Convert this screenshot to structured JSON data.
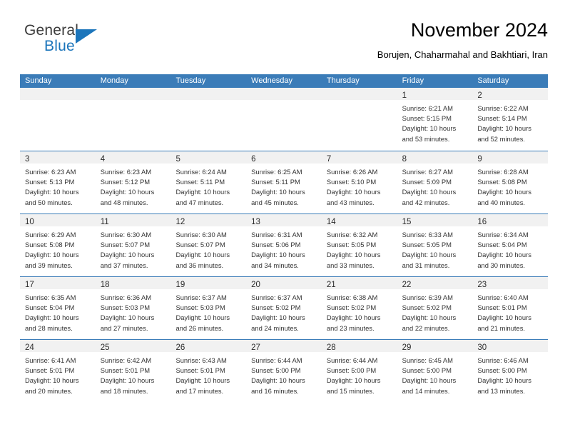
{
  "brand": {
    "name_part1": "General",
    "name_part2": "Blue",
    "color_primary": "#1b75bb",
    "color_text": "#3c3c3c",
    "triangle_icon": "triangle-icon"
  },
  "header": {
    "title": "November 2024",
    "subtitle": "Borujen, Chaharmahal and Bakhtiari, Iran"
  },
  "calendar": {
    "header_bg": "#3b7cb8",
    "daynum_bg": "#f1f1f1",
    "weekdays": [
      "Sunday",
      "Monday",
      "Tuesday",
      "Wednesday",
      "Thursday",
      "Friday",
      "Saturday"
    ],
    "weeks": [
      [
        {
          "day": "",
          "lines": []
        },
        {
          "day": "",
          "lines": []
        },
        {
          "day": "",
          "lines": []
        },
        {
          "day": "",
          "lines": []
        },
        {
          "day": "",
          "lines": []
        },
        {
          "day": "1",
          "lines": [
            "Sunrise: 6:21 AM",
            "Sunset: 5:15 PM",
            "Daylight: 10 hours",
            "and 53 minutes."
          ]
        },
        {
          "day": "2",
          "lines": [
            "Sunrise: 6:22 AM",
            "Sunset: 5:14 PM",
            "Daylight: 10 hours",
            "and 52 minutes."
          ]
        }
      ],
      [
        {
          "day": "3",
          "lines": [
            "Sunrise: 6:23 AM",
            "Sunset: 5:13 PM",
            "Daylight: 10 hours",
            "and 50 minutes."
          ]
        },
        {
          "day": "4",
          "lines": [
            "Sunrise: 6:23 AM",
            "Sunset: 5:12 PM",
            "Daylight: 10 hours",
            "and 48 minutes."
          ]
        },
        {
          "day": "5",
          "lines": [
            "Sunrise: 6:24 AM",
            "Sunset: 5:11 PM",
            "Daylight: 10 hours",
            "and 47 minutes."
          ]
        },
        {
          "day": "6",
          "lines": [
            "Sunrise: 6:25 AM",
            "Sunset: 5:11 PM",
            "Daylight: 10 hours",
            "and 45 minutes."
          ]
        },
        {
          "day": "7",
          "lines": [
            "Sunrise: 6:26 AM",
            "Sunset: 5:10 PM",
            "Daylight: 10 hours",
            "and 43 minutes."
          ]
        },
        {
          "day": "8",
          "lines": [
            "Sunrise: 6:27 AM",
            "Sunset: 5:09 PM",
            "Daylight: 10 hours",
            "and 42 minutes."
          ]
        },
        {
          "day": "9",
          "lines": [
            "Sunrise: 6:28 AM",
            "Sunset: 5:08 PM",
            "Daylight: 10 hours",
            "and 40 minutes."
          ]
        }
      ],
      [
        {
          "day": "10",
          "lines": [
            "Sunrise: 6:29 AM",
            "Sunset: 5:08 PM",
            "Daylight: 10 hours",
            "and 39 minutes."
          ]
        },
        {
          "day": "11",
          "lines": [
            "Sunrise: 6:30 AM",
            "Sunset: 5:07 PM",
            "Daylight: 10 hours",
            "and 37 minutes."
          ]
        },
        {
          "day": "12",
          "lines": [
            "Sunrise: 6:30 AM",
            "Sunset: 5:07 PM",
            "Daylight: 10 hours",
            "and 36 minutes."
          ]
        },
        {
          "day": "13",
          "lines": [
            "Sunrise: 6:31 AM",
            "Sunset: 5:06 PM",
            "Daylight: 10 hours",
            "and 34 minutes."
          ]
        },
        {
          "day": "14",
          "lines": [
            "Sunrise: 6:32 AM",
            "Sunset: 5:05 PM",
            "Daylight: 10 hours",
            "and 33 minutes."
          ]
        },
        {
          "day": "15",
          "lines": [
            "Sunrise: 6:33 AM",
            "Sunset: 5:05 PM",
            "Daylight: 10 hours",
            "and 31 minutes."
          ]
        },
        {
          "day": "16",
          "lines": [
            "Sunrise: 6:34 AM",
            "Sunset: 5:04 PM",
            "Daylight: 10 hours",
            "and 30 minutes."
          ]
        }
      ],
      [
        {
          "day": "17",
          "lines": [
            "Sunrise: 6:35 AM",
            "Sunset: 5:04 PM",
            "Daylight: 10 hours",
            "and 28 minutes."
          ]
        },
        {
          "day": "18",
          "lines": [
            "Sunrise: 6:36 AM",
            "Sunset: 5:03 PM",
            "Daylight: 10 hours",
            "and 27 minutes."
          ]
        },
        {
          "day": "19",
          "lines": [
            "Sunrise: 6:37 AM",
            "Sunset: 5:03 PM",
            "Daylight: 10 hours",
            "and 26 minutes."
          ]
        },
        {
          "day": "20",
          "lines": [
            "Sunrise: 6:37 AM",
            "Sunset: 5:02 PM",
            "Daylight: 10 hours",
            "and 24 minutes."
          ]
        },
        {
          "day": "21",
          "lines": [
            "Sunrise: 6:38 AM",
            "Sunset: 5:02 PM",
            "Daylight: 10 hours",
            "and 23 minutes."
          ]
        },
        {
          "day": "22",
          "lines": [
            "Sunrise: 6:39 AM",
            "Sunset: 5:02 PM",
            "Daylight: 10 hours",
            "and 22 minutes."
          ]
        },
        {
          "day": "23",
          "lines": [
            "Sunrise: 6:40 AM",
            "Sunset: 5:01 PM",
            "Daylight: 10 hours",
            "and 21 minutes."
          ]
        }
      ],
      [
        {
          "day": "24",
          "lines": [
            "Sunrise: 6:41 AM",
            "Sunset: 5:01 PM",
            "Daylight: 10 hours",
            "and 20 minutes."
          ]
        },
        {
          "day": "25",
          "lines": [
            "Sunrise: 6:42 AM",
            "Sunset: 5:01 PM",
            "Daylight: 10 hours",
            "and 18 minutes."
          ]
        },
        {
          "day": "26",
          "lines": [
            "Sunrise: 6:43 AM",
            "Sunset: 5:01 PM",
            "Daylight: 10 hours",
            "and 17 minutes."
          ]
        },
        {
          "day": "27",
          "lines": [
            "Sunrise: 6:44 AM",
            "Sunset: 5:00 PM",
            "Daylight: 10 hours",
            "and 16 minutes."
          ]
        },
        {
          "day": "28",
          "lines": [
            "Sunrise: 6:44 AM",
            "Sunset: 5:00 PM",
            "Daylight: 10 hours",
            "and 15 minutes."
          ]
        },
        {
          "day": "29",
          "lines": [
            "Sunrise: 6:45 AM",
            "Sunset: 5:00 PM",
            "Daylight: 10 hours",
            "and 14 minutes."
          ]
        },
        {
          "day": "30",
          "lines": [
            "Sunrise: 6:46 AM",
            "Sunset: 5:00 PM",
            "Daylight: 10 hours",
            "and 13 minutes."
          ]
        }
      ]
    ]
  }
}
